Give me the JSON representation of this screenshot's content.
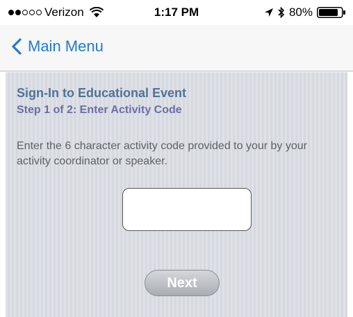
{
  "status_bar": {
    "carrier": "Verizon",
    "time": "1:17 PM",
    "battery": "80%",
    "signal_bars_filled": 2,
    "signal_bars_total": 5
  },
  "nav": {
    "back_label": "Main Menu",
    "accent_color": "#1e7bd6"
  },
  "page": {
    "title": "Sign-In to Educational Event",
    "subtitle": "Step 1 of 2: Enter Activity Code",
    "instructions": "Enter the 6 character activity code provided to your by your activity coordinator or speaker.",
    "code_input_value": "",
    "next_label": "Next"
  },
  "icons": [
    "signal-icon",
    "wifi-icon",
    "location-arrow-icon",
    "bluetooth-icon",
    "battery-icon",
    "chevron-left-icon"
  ]
}
